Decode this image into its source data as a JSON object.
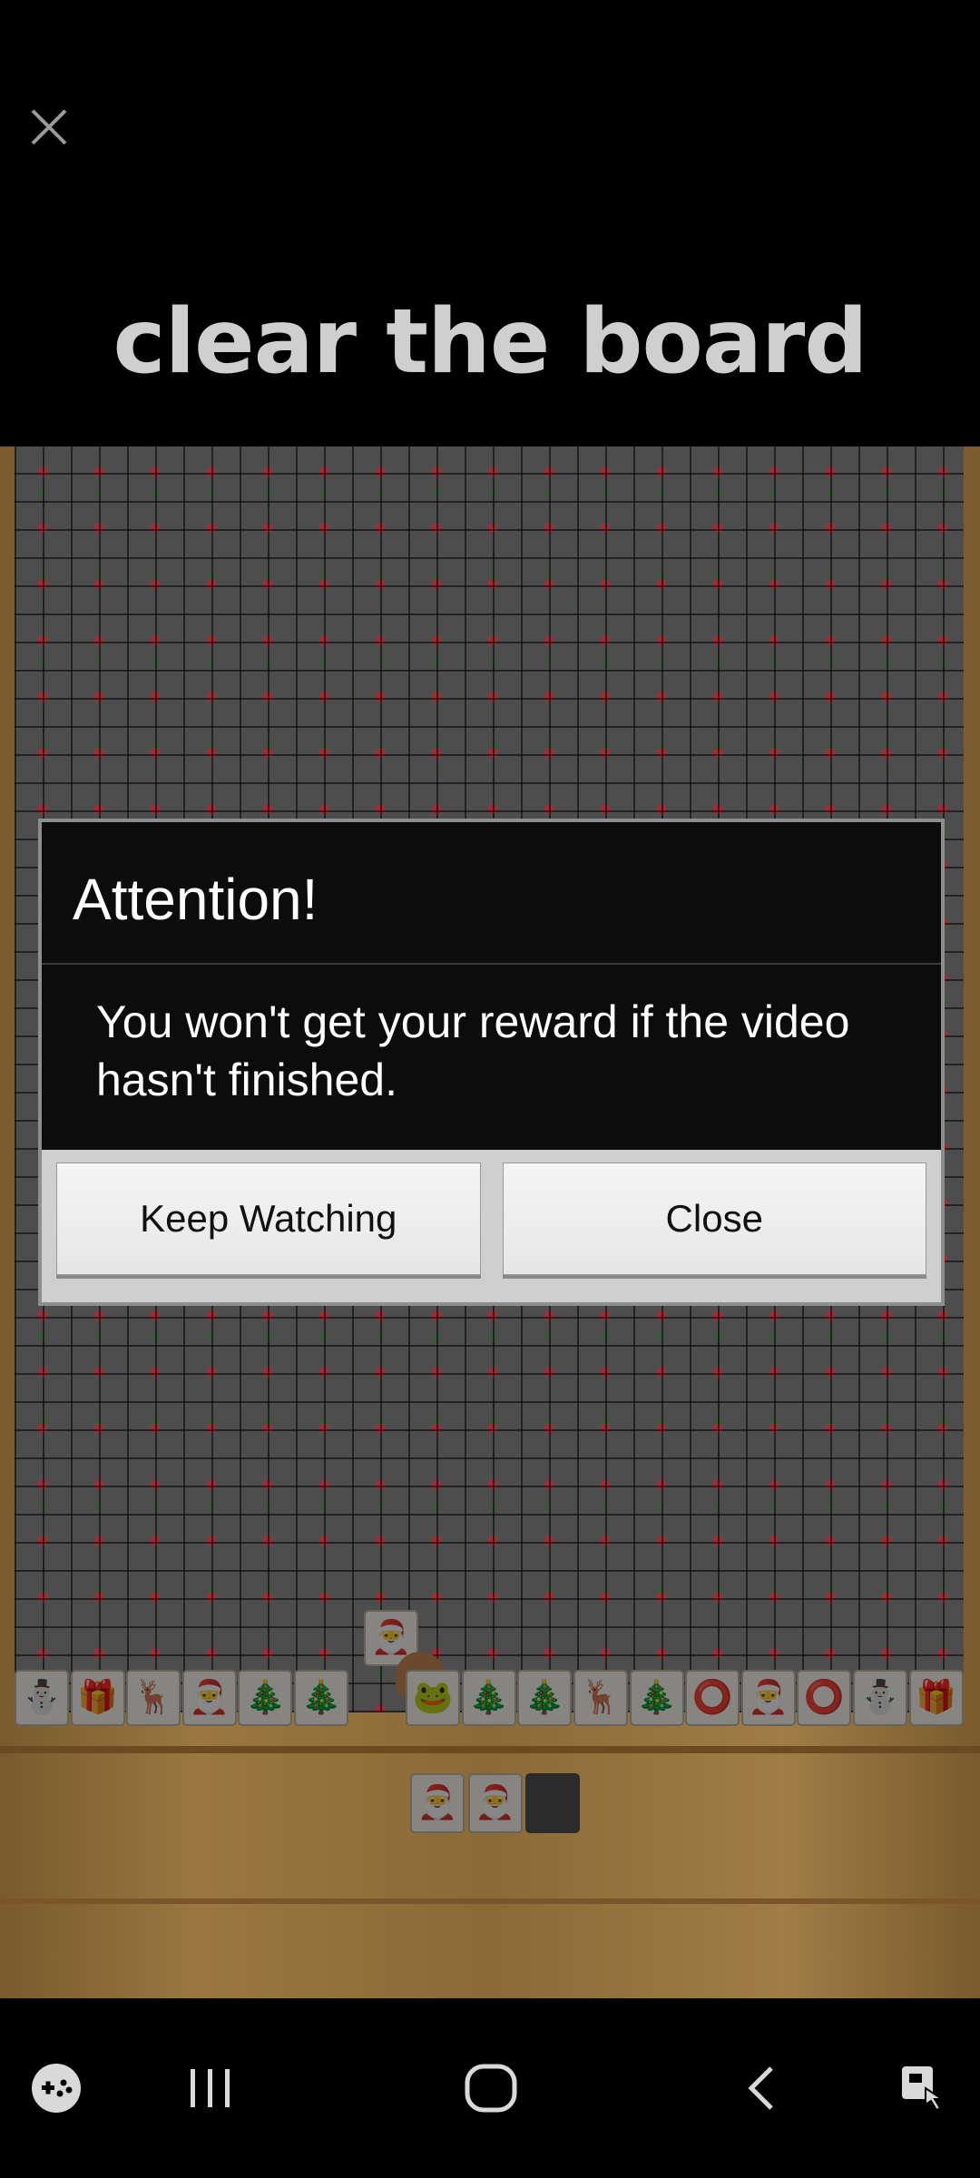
{
  "ad": {
    "close_icon": "close-icon",
    "title": "clear the board"
  },
  "game": {
    "row_tiles": [
      "⛄",
      "🎁",
      "🦌",
      "🎅",
      "🎄",
      "🎄",
      "",
      "🐸",
      "🎄",
      "🎄",
      "🦌",
      "🎄",
      "⭕",
      "🎅",
      "⭕",
      "⛄",
      "🎁"
    ],
    "lifted_tile": "🎅",
    "tray_tiles": [
      "🎅",
      "🎅"
    ]
  },
  "dialog": {
    "title": "Attention!",
    "message": "You won't get your reward if the video hasn't finished.",
    "keep_watching_label": "Keep Watching",
    "close_label": "Close"
  },
  "navbar": {
    "game_tools_icon": "game-controller-icon",
    "recents_icon": "recents-icon",
    "home_icon": "home-icon",
    "back_icon": "back-icon",
    "assistant_icon": "accessibility-icon"
  }
}
